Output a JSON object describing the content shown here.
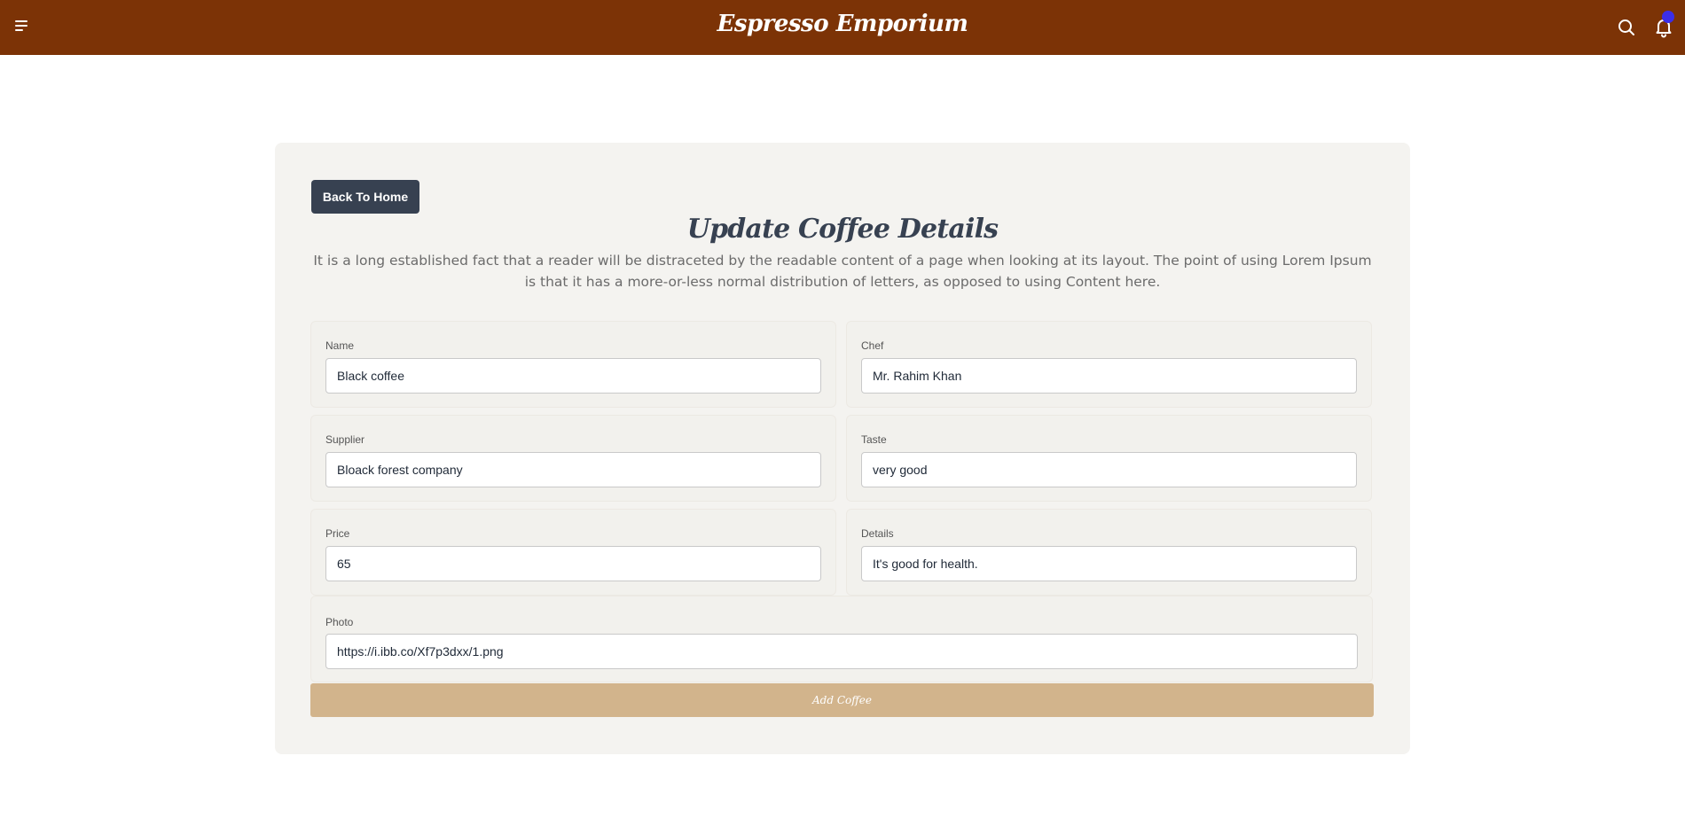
{
  "header": {
    "brand": "Espresso Emporium",
    "background_color": "#7c3306",
    "badge_color": "#3b2ee8",
    "icons": [
      "menu-icon",
      "search-icon",
      "bell-icon"
    ]
  },
  "page": {
    "back_button_label": "Back To Home",
    "title": "Update Coffee Details",
    "description": "It is a long established fact that a reader will be distraceted by the readable content of a page when looking at its layout. The point of using Lorem Ipsum is that it has a more-or-less normal distribution of letters, as opposed to using Content here."
  },
  "form": {
    "name": {
      "label": "Name",
      "value": "Black coffee"
    },
    "chef": {
      "label": "Chef",
      "value": "Mr. Rahim Khan"
    },
    "supplier": {
      "label": "Supplier",
      "value": "Bloack forest company"
    },
    "taste": {
      "label": "Taste",
      "value": "very good"
    },
    "price": {
      "label": "Price",
      "value": "65"
    },
    "details": {
      "label": "Details",
      "value": "It's good for health."
    },
    "photo": {
      "label": "Photo",
      "value": "https://i.ibb.co/Xf7p3dxx/1.png"
    },
    "submit_label": "Add Coffee"
  },
  "colors": {
    "back_button": "#374151",
    "submit_button": "#d2b48c",
    "card_background": "#f4f3f0"
  }
}
